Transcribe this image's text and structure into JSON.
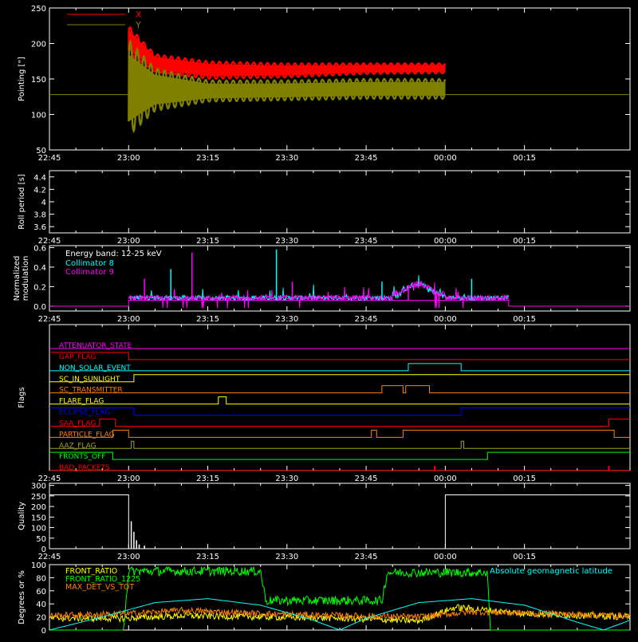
{
  "time_axis": {
    "tick_labels": [
      "22:45",
      "23:00",
      "23:15",
      "23:30",
      "23:45",
      "00:00",
      "00:15"
    ],
    "range_minutes": [
      -15,
      95
    ]
  },
  "colors": {
    "axis": "#ffffff",
    "red": "#ff0000",
    "olive": "#808000",
    "cyan": "#00ffff",
    "magenta": "#ff00ff",
    "blue": "#0000ff",
    "orange": "#ff8000",
    "yellow": "#ffff00",
    "green": "#00ff00",
    "olive_light": "#a0a020"
  },
  "chart_data": [
    {
      "type": "line",
      "ylabel": "Pointing [\"]",
      "ylim": [
        50,
        250
      ],
      "yticks": [
        50,
        100,
        150,
        200,
        250
      ],
      "x_units": "minutes from 23:00",
      "series": [
        {
          "name": "X",
          "color": "#ff0000",
          "band_upper": [
            [
              0,
              225
            ],
            [
              5,
              185
            ],
            [
              15,
              175
            ],
            [
              30,
              172
            ],
            [
              45,
              172
            ],
            [
              60,
              172
            ]
          ],
          "band_lower": [
            [
              0,
              185
            ],
            [
              5,
              160
            ],
            [
              15,
              150
            ],
            [
              30,
              152
            ],
            [
              45,
              157
            ],
            [
              60,
              158
            ]
          ]
        },
        {
          "name": "Y",
          "color": "#808000",
          "band_upper": [
            [
              0,
              205
            ],
            [
              5,
              165
            ],
            [
              15,
              148
            ],
            [
              30,
              148
            ],
            [
              45,
              150
            ],
            [
              60,
              150
            ]
          ],
          "band_lower": [
            [
              0,
              70
            ],
            [
              5,
              105
            ],
            [
              15,
              118
            ],
            [
              30,
              120
            ],
            [
              45,
              122
            ],
            [
              60,
              122
            ]
          ]
        }
      ],
      "reference_line": 128,
      "legend_placement": "top-left"
    },
    {
      "type": "line",
      "ylabel": "Roll period [s]",
      "ylim": [
        3.5,
        4.5
      ],
      "yticks": [
        3.6,
        3.8,
        4.0,
        4.2,
        4.4
      ],
      "series": []
    },
    {
      "type": "line",
      "ylabel": "Normalized modulation",
      "ylim": [
        -0.05,
        0.62
      ],
      "yticks": [
        0.0,
        0.2,
        0.4,
        0.6
      ],
      "yticklabels": [
        "0.0",
        "0.2",
        "0.4",
        "0.6"
      ],
      "annotation": "Energy band: 12-25 keV",
      "series": [
        {
          "name": "Collimator 8",
          "color": "#00ffff"
        },
        {
          "name": "Collimator 9",
          "color": "#ff00ff"
        }
      ],
      "active_range_minutes": [
        0,
        72
      ],
      "spikes": [
        [
          3,
          0.28
        ],
        [
          8,
          0.38
        ],
        [
          12,
          0.55
        ],
        [
          28,
          0.58
        ],
        [
          31,
          0.25
        ],
        [
          48,
          0.25
        ],
        [
          53,
          0.22
        ],
        [
          65,
          0.28
        ]
      ]
    },
    {
      "type": "line",
      "ylabel": "Flags",
      "flags": [
        {
          "name": "ATTENUATOR_STATE",
          "color": "#ff00ff",
          "segments": [
            [
              -15,
              95,
              0
            ]
          ]
        },
        {
          "name": "GAP_FLAG",
          "color": "#ff0000",
          "segments": [
            [
              -15,
              0,
              1
            ],
            [
              0,
              95,
              0
            ]
          ]
        },
        {
          "name": "NON_SOLAR_EVENT",
          "color": "#00ffff",
          "segments": [
            [
              -15,
              53,
              0
            ],
            [
              53,
              63,
              1
            ],
            [
              63,
              95,
              0
            ]
          ]
        },
        {
          "name": "SC_IN_SUNLIGHT",
          "color": "#ffff00",
          "segments": [
            [
              -15,
              1,
              0
            ],
            [
              1,
              95,
              1
            ]
          ]
        },
        {
          "name": "SC_TRANSMITTER",
          "color": "#ff8000",
          "segments": [
            [
              -15,
              48,
              0
            ],
            [
              48,
              52,
              1
            ],
            [
              52,
              52.5,
              0
            ],
            [
              52.5,
              57,
              1
            ],
            [
              57,
              95,
              0
            ]
          ]
        },
        {
          "name": "FLARE_FLAG",
          "color": "#ffff00",
          "segments": [
            [
              -15,
              17,
              0
            ],
            [
              17,
              18.5,
              1
            ],
            [
              18.5,
              95,
              0
            ]
          ]
        },
        {
          "name": "ECLIPSE_FLAG",
          "color": "#0000ff",
          "segments": [
            [
              -15,
              1,
              1
            ],
            [
              1,
              63,
              0
            ],
            [
              63,
              95,
              1
            ]
          ]
        },
        {
          "name": "SAA_FLAG",
          "color": "#ff0000",
          "segments": [
            [
              -15,
              -5.5,
              0
            ],
            [
              -5.5,
              -2.5,
              1
            ],
            [
              -2.5,
              91,
              0
            ],
            [
              91,
              95,
              1
            ]
          ]
        },
        {
          "name": "PARTICLE_FLAG",
          "color": "#ff8000",
          "segments": [
            [
              -15,
              -3,
              0
            ],
            [
              -3,
              0,
              1
            ],
            [
              0,
              46,
              0
            ],
            [
              46,
              47,
              1
            ],
            [
              47,
              52,
              0
            ],
            [
              52,
              92,
              1
            ],
            [
              92,
              95,
              0
            ]
          ]
        },
        {
          "name": "AAZ_FLAG",
          "color": "#a0a020",
          "segments": [
            [
              -15,
              0.5,
              0
            ],
            [
              0.5,
              1,
              1
            ],
            [
              1,
              63,
              0
            ],
            [
              63,
              63.5,
              1
            ],
            [
              63.5,
              95,
              0
            ]
          ]
        },
        {
          "name": "FRONTS_OFF",
          "color": "#00ff00",
          "segments": [
            [
              -15,
              -3,
              1
            ],
            [
              -3,
              68,
              0
            ],
            [
              68,
              95,
              1
            ]
          ]
        },
        {
          "name": "BAD_PACKETS",
          "color": "#ff0000",
          "segments": [
            [
              -15,
              95,
              0
            ]
          ],
          "ticks": [
            58,
            91
          ]
        }
      ]
    },
    {
      "type": "line",
      "ylabel": "Quality",
      "ylim": [
        0,
        310
      ],
      "yticks": [
        0,
        50,
        100,
        150,
        200,
        250,
        300
      ],
      "series": [
        {
          "name": "",
          "color": "#ffffff",
          "segments": [
            [
              -15,
              255
            ],
            [
              0,
              255
            ],
            [
              0,
              0
            ],
            [
              60,
              0
            ],
            [
              60,
              255
            ],
            [
              95,
              255
            ]
          ]
        }
      ],
      "spikes": [
        [
          0.5,
          130
        ],
        [
          1,
          80
        ],
        [
          1.5,
          40
        ],
        [
          2,
          20
        ],
        [
          3,
          15
        ]
      ]
    },
    {
      "type": "line",
      "ylabel": "Degrees or %",
      "ylim": [
        0,
        100
      ],
      "yticks": [
        0,
        20,
        40,
        60,
        80,
        100
      ],
      "series": [
        {
          "name": "FRONT_RATIO",
          "color": "#ffff00",
          "level": [
            [
              -15,
              18
            ],
            [
              0,
              18
            ],
            [
              10,
              22
            ],
            [
              25,
              20
            ],
            [
              40,
              18
            ],
            [
              55,
              14
            ],
            [
              62,
              35
            ],
            [
              75,
              25
            ],
            [
              95,
              20
            ]
          ]
        },
        {
          "name": "FRONT_RATIO_1225",
          "color": "#00ff00",
          "level": [
            [
              -15,
              0
            ],
            [
              -1,
              0
            ],
            [
              0,
              90
            ],
            [
              25,
              90
            ],
            [
              26,
              45
            ],
            [
              48,
              45
            ],
            [
              49,
              88
            ],
            [
              68,
              88
            ],
            [
              68.5,
              0
            ],
            [
              95,
              0
            ]
          ]
        },
        {
          "name": "MAX_DET_VS_TOT",
          "color": "#ff8000",
          "level": [
            [
              -15,
              22
            ],
            [
              0,
              25
            ],
            [
              10,
              30
            ],
            [
              25,
              25
            ],
            [
              40,
              22
            ],
            [
              55,
              20
            ],
            [
              65,
              28
            ],
            [
              95,
              22
            ]
          ]
        },
        {
          "name": "Absolute geomagnetic latitude",
          "color": "#00ffff",
          "level": [
            [
              -15,
              0
            ],
            [
              -5,
              20
            ],
            [
              5,
              42
            ],
            [
              15,
              48
            ],
            [
              25,
              38
            ],
            [
              35,
              15
            ],
            [
              40,
              0
            ],
            [
              45,
              18
            ],
            [
              55,
              42
            ],
            [
              65,
              48
            ],
            [
              75,
              38
            ],
            [
              85,
              12
            ],
            [
              90,
              0
            ],
            [
              95,
              15
            ]
          ]
        }
      ]
    }
  ]
}
